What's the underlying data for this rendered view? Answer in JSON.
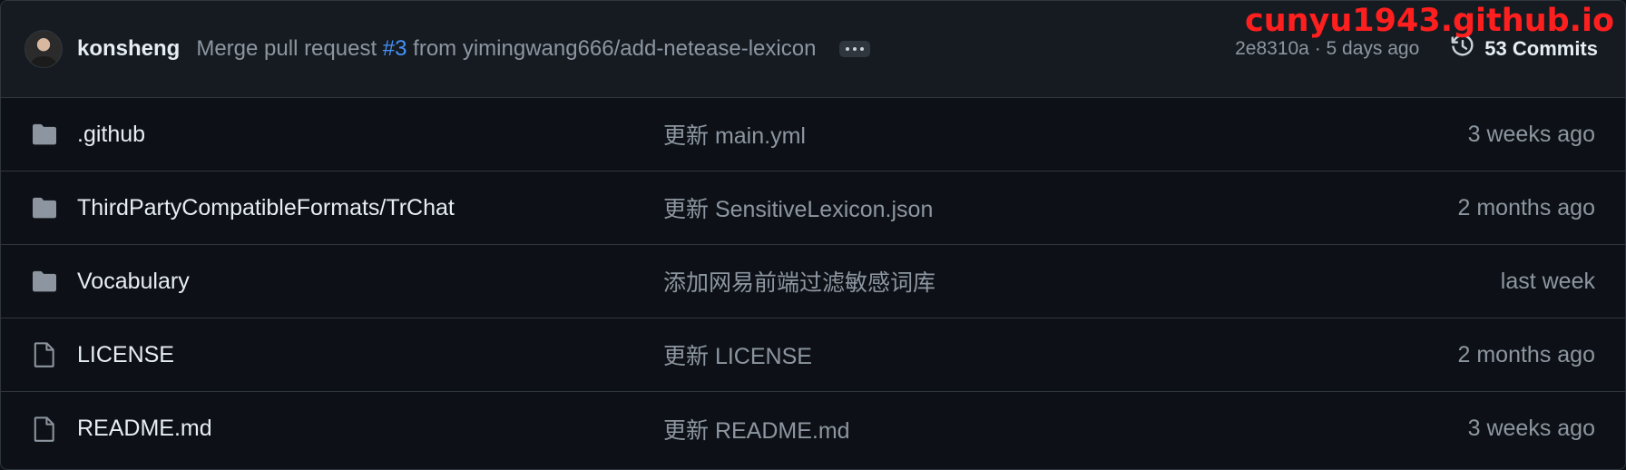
{
  "watermark": "cunyu1943.github.io",
  "latest_commit": {
    "author": "konsheng",
    "message_prefix": "Merge pull request ",
    "pr_ref": "#3",
    "message_suffix": " from yimingwang666/add-netease-lexicon",
    "sha_time": "2e8310a · 5 days ago",
    "commits_label": "53 Commits"
  },
  "colors": {
    "background": "#0d1117",
    "header_background": "#161b22",
    "border": "#30363d",
    "link": "#4493f8",
    "muted_text": "#8d96a0",
    "watermark": "#ff1f1f"
  },
  "files": [
    {
      "icon": "folder-icon",
      "name": ".github",
      "message": "更新 main.yml",
      "age": "3 weeks ago"
    },
    {
      "icon": "folder-icon",
      "name": "ThirdPartyCompatibleFormats/TrChat",
      "message": "更新 SensitiveLexicon.json",
      "age": "2 months ago"
    },
    {
      "icon": "folder-icon",
      "name": "Vocabulary",
      "message": "添加网易前端过滤敏感词库",
      "age": "last week"
    },
    {
      "icon": "file-icon",
      "name": "LICENSE",
      "message": "更新 LICENSE",
      "age": "2 months ago"
    },
    {
      "icon": "file-icon",
      "name": "README.md",
      "message": "更新 README.md",
      "age": "3 weeks ago"
    }
  ]
}
